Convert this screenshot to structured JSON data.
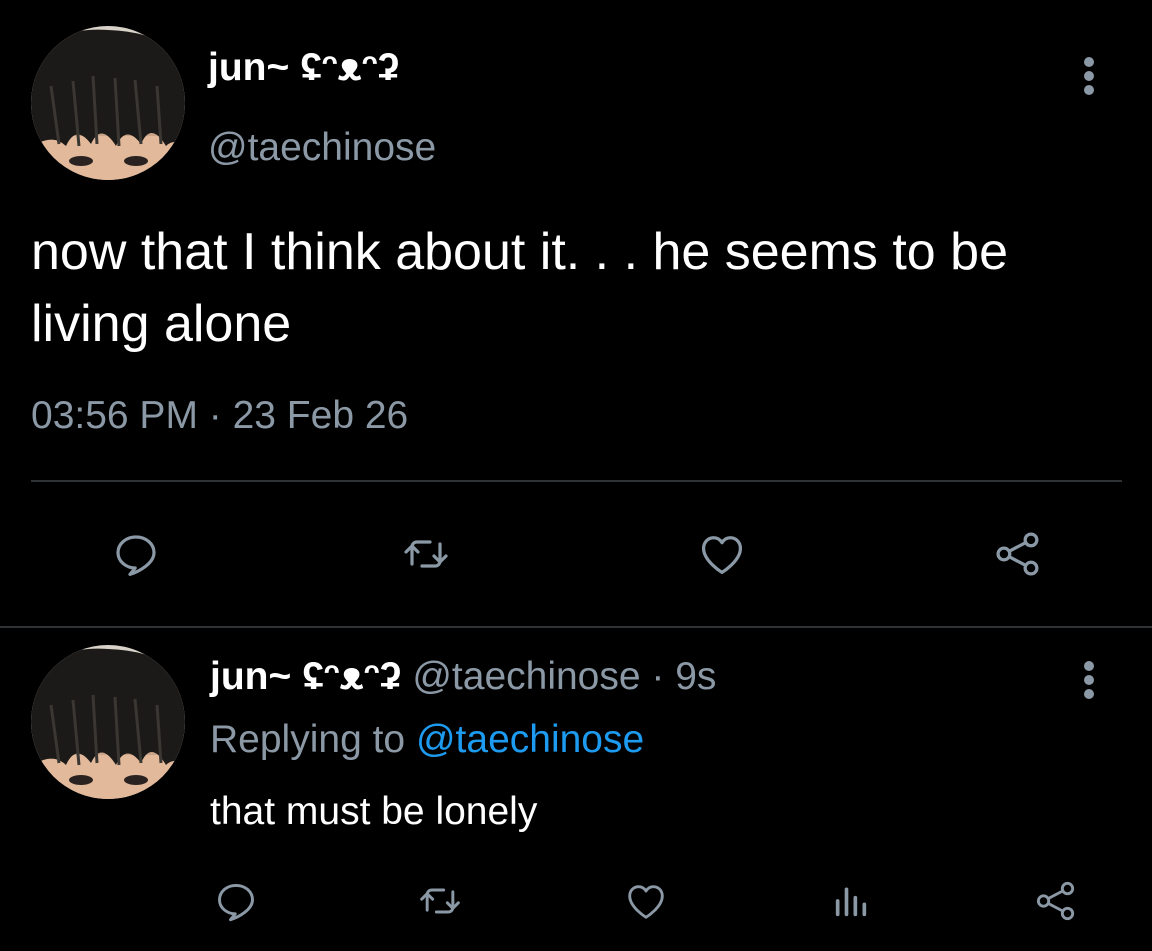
{
  "main_tweet": {
    "display_name": "jun~ ʢᵔᴥᵔʡ",
    "handle": "@taechinose",
    "text": "now that I think about it. . . he seems to be living alone",
    "timestamp": "03:56 PM · 23 Feb 26",
    "actions": [
      {
        "name": "reply",
        "icon": "comment-icon"
      },
      {
        "name": "retweet",
        "icon": "retweet-icon"
      },
      {
        "name": "like",
        "icon": "heart-icon"
      },
      {
        "name": "share",
        "icon": "share-icon"
      }
    ]
  },
  "reply_tweet": {
    "display_name": "jun~ ʢᵔᴥᵔʡ",
    "handle_meta": " @taechinose · 9s",
    "replying_prefix": "Replying to ",
    "replying_to": "@taechinose",
    "text": "that must be lonely",
    "actions": [
      {
        "name": "reply",
        "icon": "comment-icon"
      },
      {
        "name": "retweet",
        "icon": "retweet-icon"
      },
      {
        "name": "like",
        "icon": "heart-icon"
      },
      {
        "name": "analytics",
        "icon": "analytics-icon"
      },
      {
        "name": "share",
        "icon": "share-icon"
      }
    ]
  },
  "colors": {
    "background": "#000000",
    "primary_text": "#ffffff",
    "secondary_text": "#8b98a5",
    "link": "#1d9bf0",
    "divider": "#2f3336"
  }
}
